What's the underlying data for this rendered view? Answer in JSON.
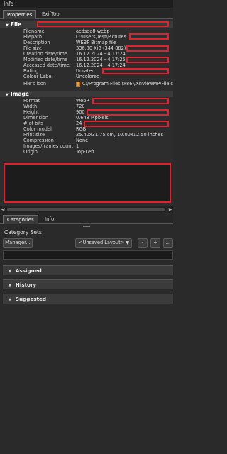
{
  "window": {
    "title": "Info"
  },
  "top_tabs": [
    {
      "label": "Properties"
    },
    {
      "label": "ExifTool"
    }
  ],
  "sections": {
    "file": {
      "title": "File",
      "rows": [
        {
          "key": "Filename",
          "value": "acdsee8.webp"
        },
        {
          "key": "Filepath",
          "value": "C:\\Users\\Test\\Pictures"
        },
        {
          "key": "Description",
          "value": "WEBP Bitmap file"
        },
        {
          "key": "File size",
          "value": "336.80 KiB (344 882)"
        },
        {
          "key": "Creation date/time",
          "value": "16.12.2024 - 4:17:24"
        },
        {
          "key": "Modified date/time",
          "value": "16.12.2024 - 4:17:25"
        },
        {
          "key": "Accessed date/time",
          "value": "16.12.2024 - 4:17:24"
        },
        {
          "key": "Rating",
          "value": "Unrated"
        },
        {
          "key": "Colour Label",
          "value": "Uncolored"
        },
        {
          "key": "File's icon",
          "value": "C:/Program Files (x86)/XnViewMP/FileIc"
        }
      ]
    },
    "image": {
      "title": "Image",
      "rows": [
        {
          "key": "Format",
          "value": "WebP"
        },
        {
          "key": "Width",
          "value": "720"
        },
        {
          "key": "Height",
          "value": "900"
        },
        {
          "key": "Dimension",
          "value": "0.648 Mpixels"
        },
        {
          "key": "# of bits",
          "value": "24"
        },
        {
          "key": "Color model",
          "value": "RGB"
        },
        {
          "key": "Print size",
          "value": "25.40x31.75 cm, 10.00x12.50 inches"
        },
        {
          "key": "Compression",
          "value": "None"
        },
        {
          "key": "Images/frames count",
          "value": "1"
        },
        {
          "key": "Origin",
          "value": "Top-Left"
        }
      ]
    }
  },
  "bottom_tabs": [
    {
      "label": "Categories"
    },
    {
      "label": "Info"
    }
  ],
  "categories": {
    "title": "Category Sets",
    "manager_label": "Manager...",
    "layout_select": "<Unsaved Layout>",
    "minus_label": "-",
    "plus_label": "+",
    "more_label": "..."
  },
  "accordions": [
    {
      "label": "Assigned"
    },
    {
      "label": "History"
    },
    {
      "label": "Suggested"
    }
  ],
  "colors": {
    "redaction": "#e0202a",
    "background": "#2a2a2a",
    "section_header": "#3a3a3a"
  },
  "icons": [
    "file-type-icon",
    "collapse-triangle-icon",
    "dropdown-chevron-icon"
  ]
}
